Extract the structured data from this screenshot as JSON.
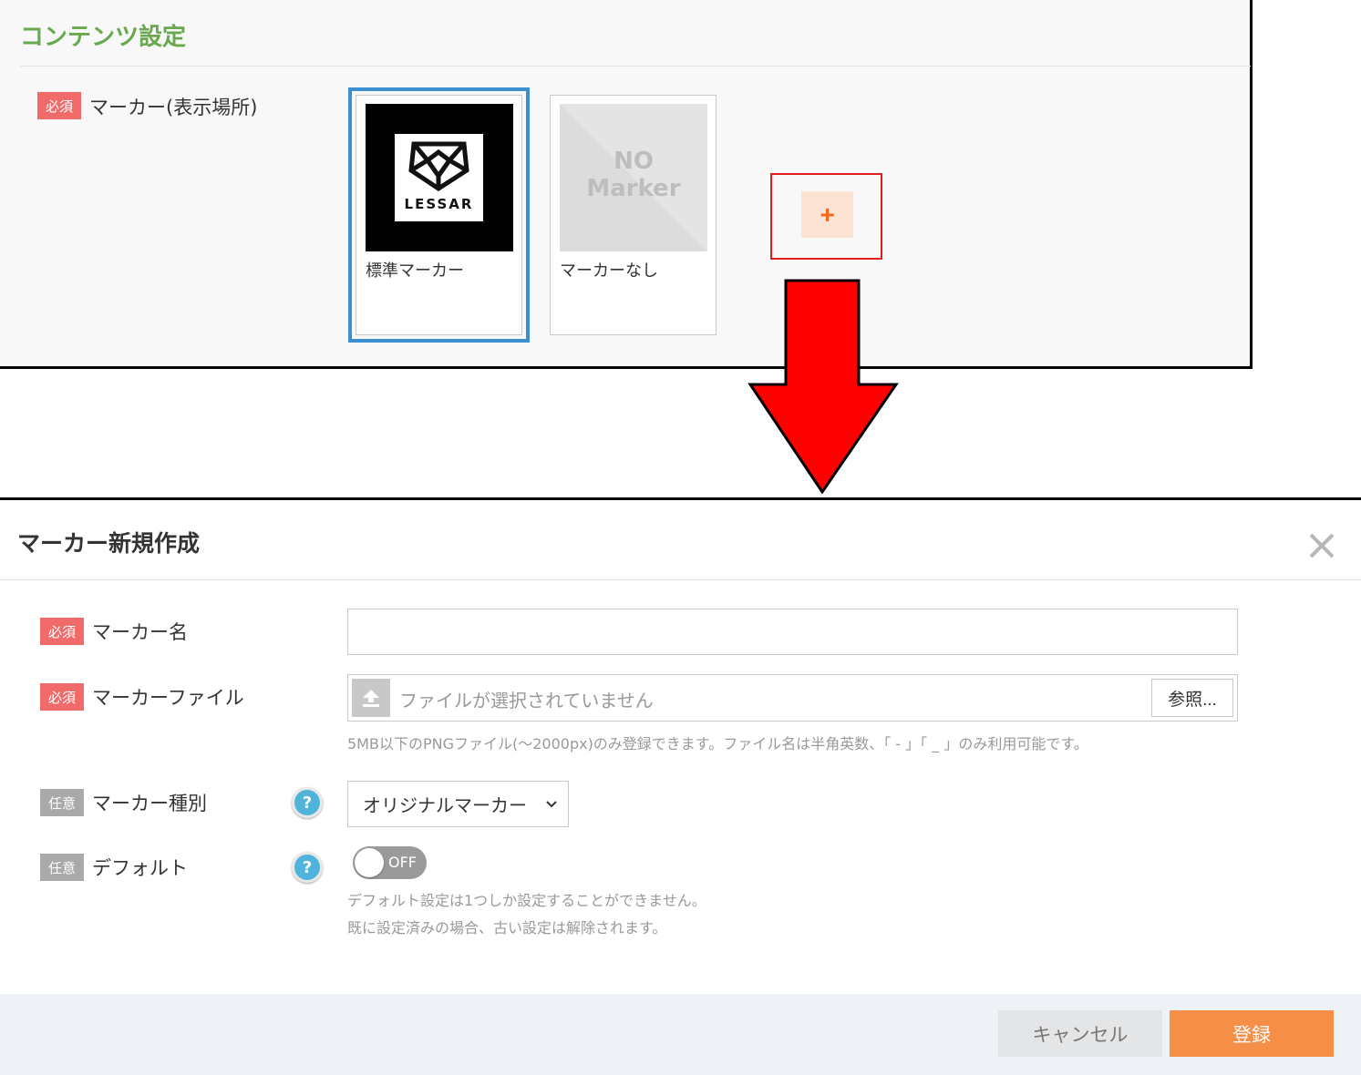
{
  "content_settings": {
    "title": "コンテンツ設定",
    "marker_field": {
      "badge": "必須",
      "label": "マーカー(表示場所)"
    },
    "markers": [
      {
        "caption": "標準マーカー",
        "logo_text": "LESSAR",
        "selected": true
      },
      {
        "caption": "マーカーなし",
        "placeholder_line1": "NO",
        "placeholder_line2": "Marker",
        "selected": false
      }
    ],
    "add_button_icon": "plus-icon",
    "add_button_symbol": "+"
  },
  "modal": {
    "title": "マーカー新規作成",
    "close_symbol": "✕",
    "fields": {
      "name": {
        "badge": "必須",
        "label": "マーカー名",
        "value": ""
      },
      "file": {
        "badge": "必須",
        "label": "マーカーファイル",
        "status": "ファイルが選択されていません",
        "browse_label": "参照...",
        "help": "5MB以下のPNGファイル(〜2000px)のみ登録できます。ファイル名は半角英数、「 - 」「 _ 」のみ利用可能です。"
      },
      "type": {
        "badge": "任意",
        "label": "マーカー種別",
        "help_symbol": "?",
        "selected": "オリジナルマーカー"
      },
      "default": {
        "badge": "任意",
        "label": "デフォルト",
        "help_symbol": "?",
        "toggle_state": "OFF",
        "help_line1": "デフォルト設定は1つしか設定することができません。",
        "help_line2": "既に設定済みの場合、古い設定は解除されます。"
      }
    },
    "footer": {
      "cancel_label": "キャンセル",
      "submit_label": "登録"
    }
  },
  "colors": {
    "section_title": "#6aa84f",
    "required_badge": "#f26b6b",
    "optional_badge": "#a9a9a9",
    "selected_outline": "#3d8fd1",
    "highlight_box": "#e01e1e",
    "arrow": "#ff0000",
    "submit": "#f58e46"
  }
}
